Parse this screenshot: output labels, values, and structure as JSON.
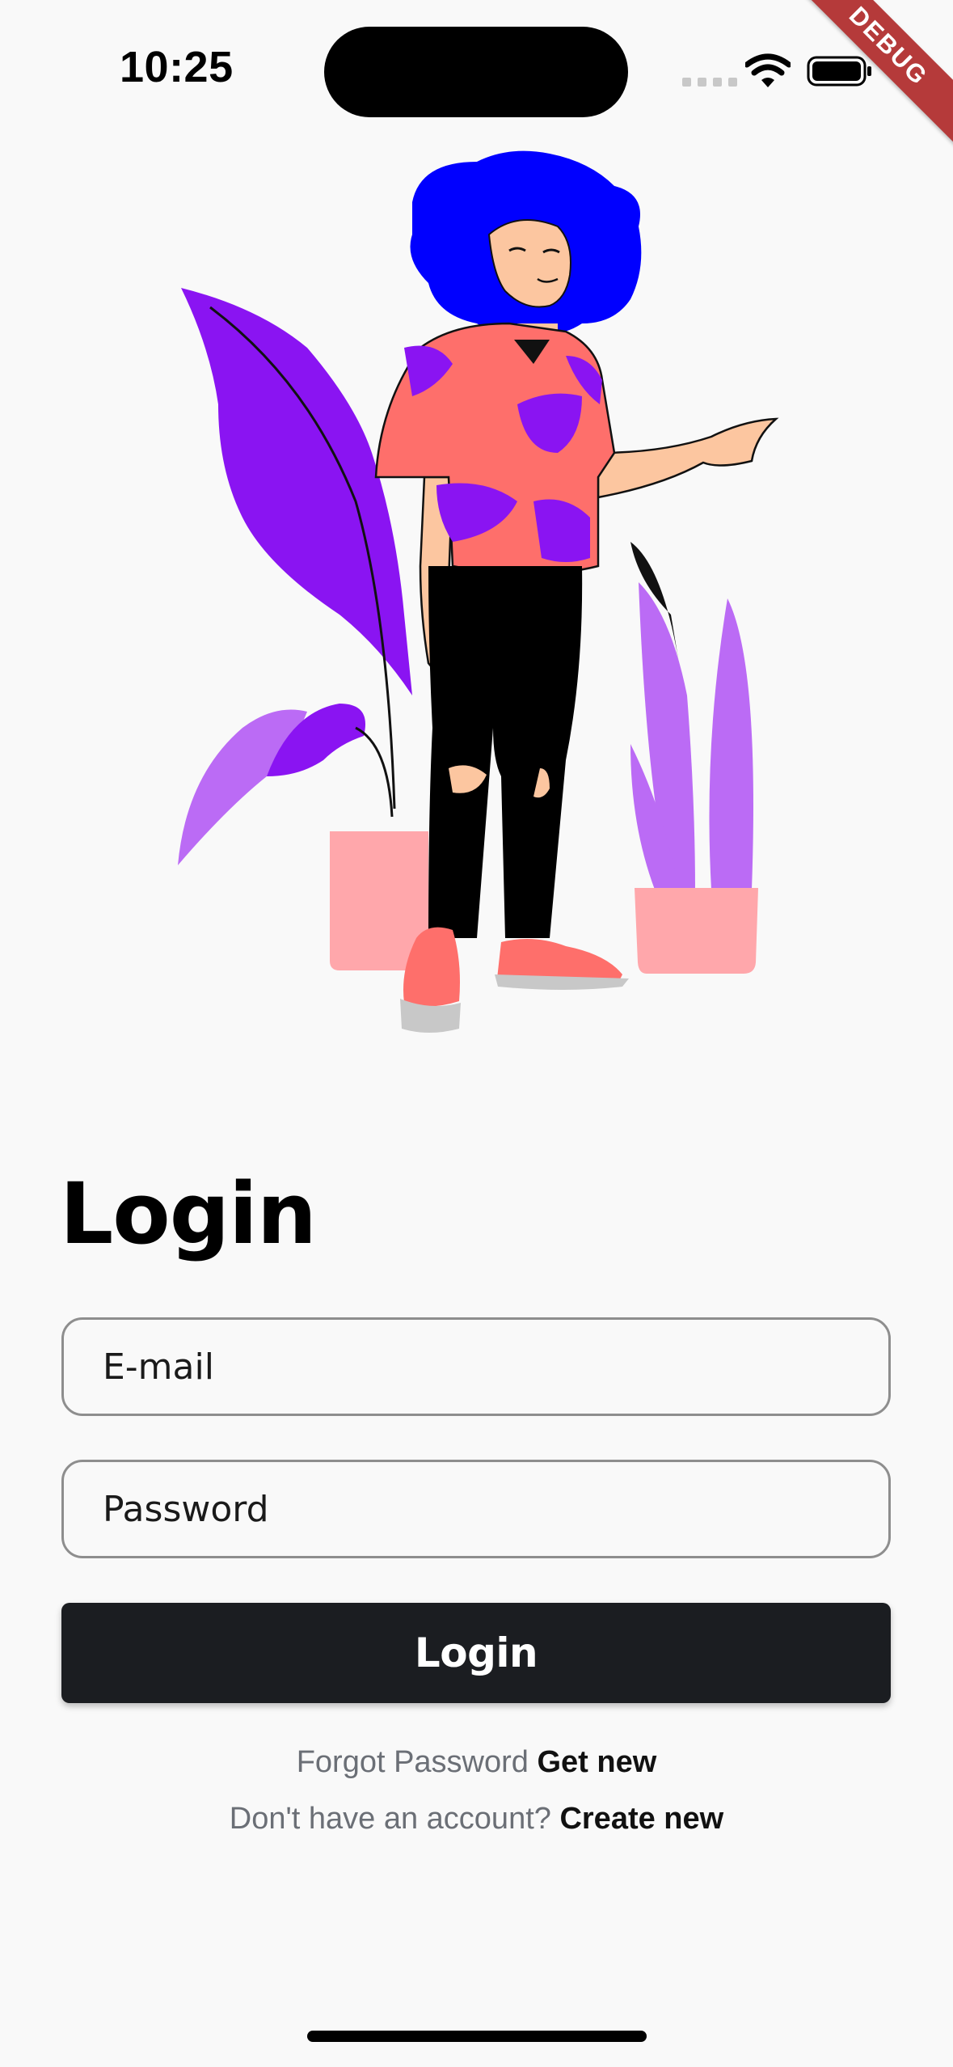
{
  "status_bar": {
    "time": "10:25"
  },
  "debug_banner": "DEBUG",
  "login": {
    "title": "Login",
    "email_placeholder": "E-mail",
    "password_placeholder": "Password",
    "button_label": "Login",
    "forgot_text": "Forgot Password",
    "forgot_link": "Get new",
    "signup_text": "Don't have an account?",
    "signup_link": "Create new"
  },
  "colors": {
    "background": "#f9f9f9",
    "button": "#1b1d21",
    "hair": "#0000ff",
    "plant_dark": "#8a14f2",
    "plant_light": "#bb6bf5",
    "pot": "#ffa7ab",
    "shirt": "#fe6f6b",
    "debug": "#b53a3a"
  }
}
